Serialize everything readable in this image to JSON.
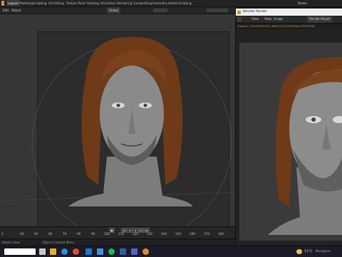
{
  "workspaces": [
    "Layout",
    "Modeling",
    "Sculpting",
    "UV Editing",
    "Texture Paint",
    "Shading",
    "Animation",
    "Rendering",
    "Compositing",
    "Geometry Nodes",
    "Scripting"
  ],
  "top_right": {
    "scene": "Scene",
    "view_layer": "ViewLayer"
  },
  "viewport_header": {
    "mode": "Edit",
    "object_menu": "Object",
    "transform": "Global"
  },
  "timeline": {
    "frame_start": "1",
    "ticks": [
      "40",
      "50",
      "60",
      "70",
      "80",
      "90",
      "100",
      "110",
      "120",
      "130",
      "140",
      "150",
      "160",
      "170",
      "180",
      "190"
    ],
    "current": "1"
  },
  "status": {
    "left": "Rotate View",
    "middle": "Object Context Menu"
  },
  "render_window": {
    "title": "Blender Render",
    "menus": [
      "View",
      "View",
      "Image"
    ],
    "slot": "Slot 1",
    "layer": "Render Result",
    "info": "Frame:1 | Time:00:03.20 | Mem:1212.31M (Peak 1373.91M)"
  },
  "taskbar": {
    "weather_temp": "11°C",
    "weather_text": "Nuageux"
  },
  "colors": {
    "accent": "#e58a2b",
    "viewport_bg": "#363636",
    "hair": "#6e3a18"
  }
}
